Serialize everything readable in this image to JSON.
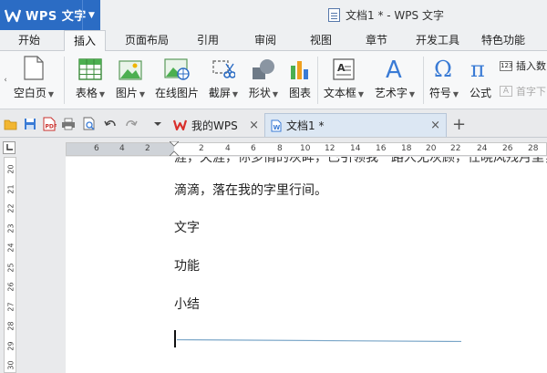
{
  "app": {
    "name": "WPS 文字",
    "window_title": "文档1 * - WPS 文字"
  },
  "menu_tabs": [
    "开始",
    "插入",
    "页面布局",
    "引用",
    "审阅",
    "视图",
    "章节",
    "开发工具",
    "特色功能"
  ],
  "active_tab": "插入",
  "ribbon": {
    "items": [
      {
        "label": "空白页",
        "icon": "blank-page-icon",
        "has_menu": true
      },
      {
        "label": "表格",
        "icon": "table-icon",
        "has_menu": true
      },
      {
        "label": "图片",
        "icon": "picture-icon",
        "has_menu": true
      },
      {
        "label": "在线图片",
        "icon": "online-picture-icon",
        "has_menu": false
      },
      {
        "label": "截屏",
        "icon": "screenshot-icon",
        "has_menu": true
      },
      {
        "label": "形状",
        "icon": "shapes-icon",
        "has_menu": true
      },
      {
        "label": "图表",
        "icon": "chart-icon",
        "has_menu": false
      },
      {
        "label": "文本框",
        "icon": "textbox-icon",
        "has_menu": true
      },
      {
        "label": "艺术字",
        "icon": "wordart-icon",
        "has_menu": true
      },
      {
        "label": "符号",
        "icon": "omega-icon",
        "has_menu": true
      },
      {
        "label": "公式",
        "icon": "pi-icon",
        "has_menu": false
      }
    ],
    "small_insert_number": "插入数",
    "small_drop_cap": "首字下"
  },
  "doc_tabs": [
    {
      "label": "我的WPS",
      "active": false
    },
    {
      "label": "文档1 *",
      "active": true
    }
  ],
  "ruler": {
    "h_numbers": [
      "6",
      "4",
      "2",
      "2",
      "4",
      "6",
      "8",
      "10",
      "12",
      "14",
      "16",
      "18",
      "20",
      "22",
      "24",
      "26",
      "28"
    ],
    "v_numbers": [
      "20",
      "21",
      "22",
      "23",
      "24",
      "25",
      "26",
      "27",
      "28",
      "29",
      "30"
    ]
  },
  "document": {
    "cut_line": "涯，天涯，你多情的灰眸，已引领我一路人无灰顾，任晓风残月里，",
    "line2": "滴滴，落在我的字里行间。",
    "heading_1": "文字",
    "heading_2": "功能",
    "heading_3": "小结"
  },
  "colors": {
    "brand": "#2b6cc4",
    "active_doc_tab": "#dce7f3",
    "line_shape": "#7aa6c8"
  }
}
